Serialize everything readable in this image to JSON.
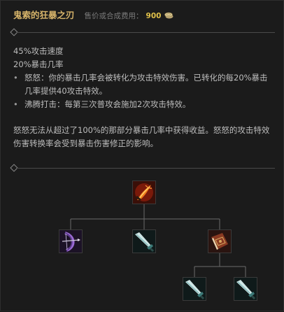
{
  "item": {
    "name": "鬼索的狂暴之刃",
    "cost_label": "售价或合成费用：",
    "cost_value": "900"
  },
  "stats": [
    "45%攻击速度",
    "20%暴击几率"
  ],
  "passives": [
    "怒怒：你的暴击几率会被转化为攻击特效伤害。已转化的每20%暴击几率提供40攻击特效。",
    "沸腾打击：每第三次普攻会施加2次攻击特效。"
  ],
  "note": "怒怒无法从超过了100%的那部分暴击几率中获得收益。怒怒的攻击特效伤害转换率会受到暴击伤害修正的影响。",
  "icons": {
    "coin": "gold-coin-icon",
    "root": "guinsoo-rageblade-icon",
    "child1": "recurve-bow-icon",
    "child2": "pickaxe-icon",
    "child3": "tome-icon",
    "grandchild1": "pickaxe-icon",
    "grandchild2": "pickaxe-icon"
  },
  "colors": {
    "title": "#d7b46a",
    "cost_value": "#e0c14a"
  }
}
